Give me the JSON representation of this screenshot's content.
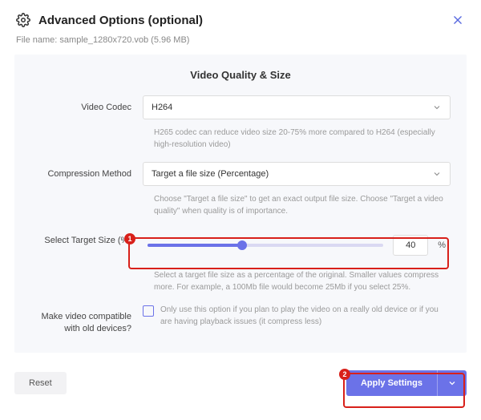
{
  "header": {
    "title": "Advanced Options (optional)"
  },
  "file": {
    "label": "File name:",
    "name": "sample_1280x720.vob (5.96 MB)"
  },
  "section": {
    "title": "Video Quality & Size"
  },
  "codec": {
    "label": "Video Codec",
    "value": "H264",
    "help": "H265 codec can reduce video size 20-75% more compared to H264 (especially high-resolution video)"
  },
  "method": {
    "label": "Compression Method",
    "value": "Target a file size (Percentage)",
    "help": "Choose \"Target a file size\" to get an exact output file size. Choose \"Target a video quality\" when quality is of importance."
  },
  "target": {
    "label": "Select Target Size (%)",
    "value": "40",
    "pct": "%",
    "help": "Select a target file size as a percentage of the original. Smaller values compress more. For example, a 100Mb file would become 25Mb if you select 25%."
  },
  "compat": {
    "label": "Make video compatible with old devices?",
    "help": "Only use this option if you plan to play the video on a really old device or if you are having playback issues (it compress less)"
  },
  "buttons": {
    "reset": "Reset",
    "apply": "Apply Settings"
  },
  "callouts": {
    "one": "1",
    "two": "2"
  }
}
